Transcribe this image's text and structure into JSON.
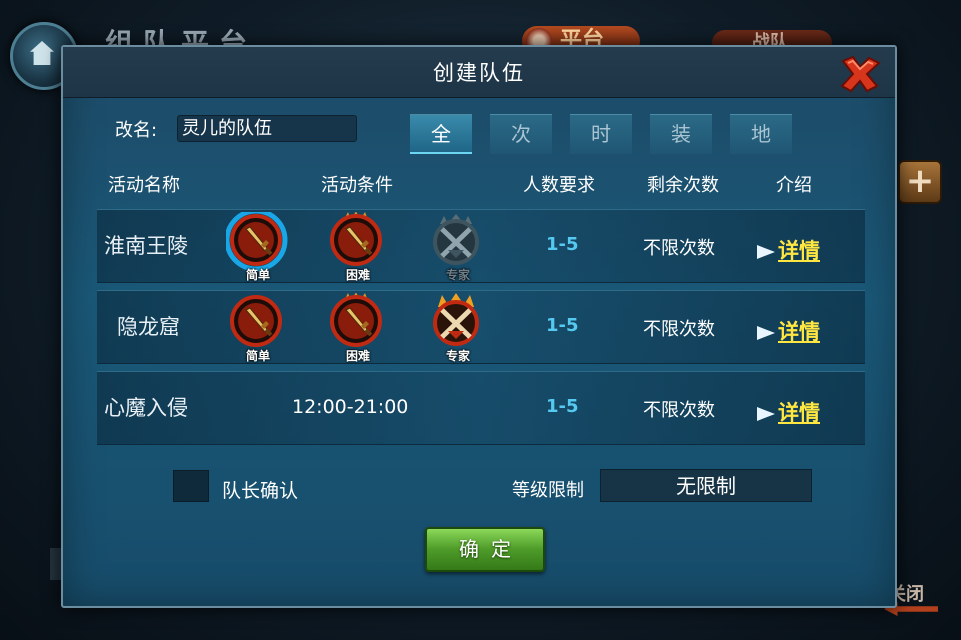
{
  "background": {
    "title": "组队平台",
    "tab_platform": "平台",
    "tab_team": "战队",
    "close_label": "关闭"
  },
  "dialog": {
    "title": "创建队伍",
    "name_label": "改名:",
    "name_value": "灵儿的队伍",
    "filter_tabs": [
      {
        "label": "全",
        "active": true
      },
      {
        "label": "次",
        "active": false
      },
      {
        "label": "时",
        "active": false
      },
      {
        "label": "装",
        "active": false
      },
      {
        "label": "地",
        "active": false
      }
    ],
    "columns": {
      "name": "活动名称",
      "condition": "活动条件",
      "team_size": "人数要求",
      "remaining": "剩余次数",
      "intro": "介绍"
    },
    "rows": [
      {
        "name": "淮南王陵",
        "difficulties": [
          {
            "label": "简单",
            "selected": true,
            "locked": false
          },
          {
            "label": "困难",
            "selected": false,
            "locked": false
          },
          {
            "label": "专家",
            "selected": false,
            "locked": true
          }
        ],
        "team_size": "1-5",
        "remaining": "不限次数",
        "detail": "详情"
      },
      {
        "name": "隐龙窟",
        "difficulties": [
          {
            "label": "简单",
            "selected": false,
            "locked": false
          },
          {
            "label": "困难",
            "selected": false,
            "locked": false
          },
          {
            "label": "专家",
            "selected": false,
            "locked": false
          }
        ],
        "team_size": "1-5",
        "remaining": "不限次数",
        "detail": "详情"
      },
      {
        "name": "心魔入侵",
        "time_range": "12:00-21:00",
        "team_size": "1-5",
        "remaining": "不限次数",
        "detail": "详情"
      }
    ],
    "leader_confirm_label": "队长确认",
    "level_limit_label": "等级限制",
    "level_limit_value": "无限制",
    "confirm_label": "确定"
  },
  "colors": {
    "accent_blue": "#55c9f0",
    "detail_yellow": "#ffe640",
    "confirm_green": "#4f9c2a",
    "close_red": "#d8361c"
  }
}
